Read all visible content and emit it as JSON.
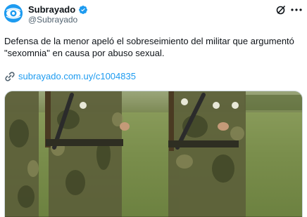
{
  "author": {
    "display_name": "Subrayado",
    "handle": "@Subrayado",
    "verified": true,
    "avatar_icon": "eye-logo-icon"
  },
  "actions": {
    "grok_icon": "grok-icon",
    "more_icon": "more-options-icon"
  },
  "tweet": {
    "text": "Defensa de la menor apeló el sobreseimiento del militar que argumentó \"sexomnia\" en causa por abuso sexual.",
    "link_icon": "link-icon",
    "link_text": "subrayado.com.uy/c1004835"
  },
  "colors": {
    "accent": "#1d9bf0",
    "secondary_text": "#536471"
  }
}
